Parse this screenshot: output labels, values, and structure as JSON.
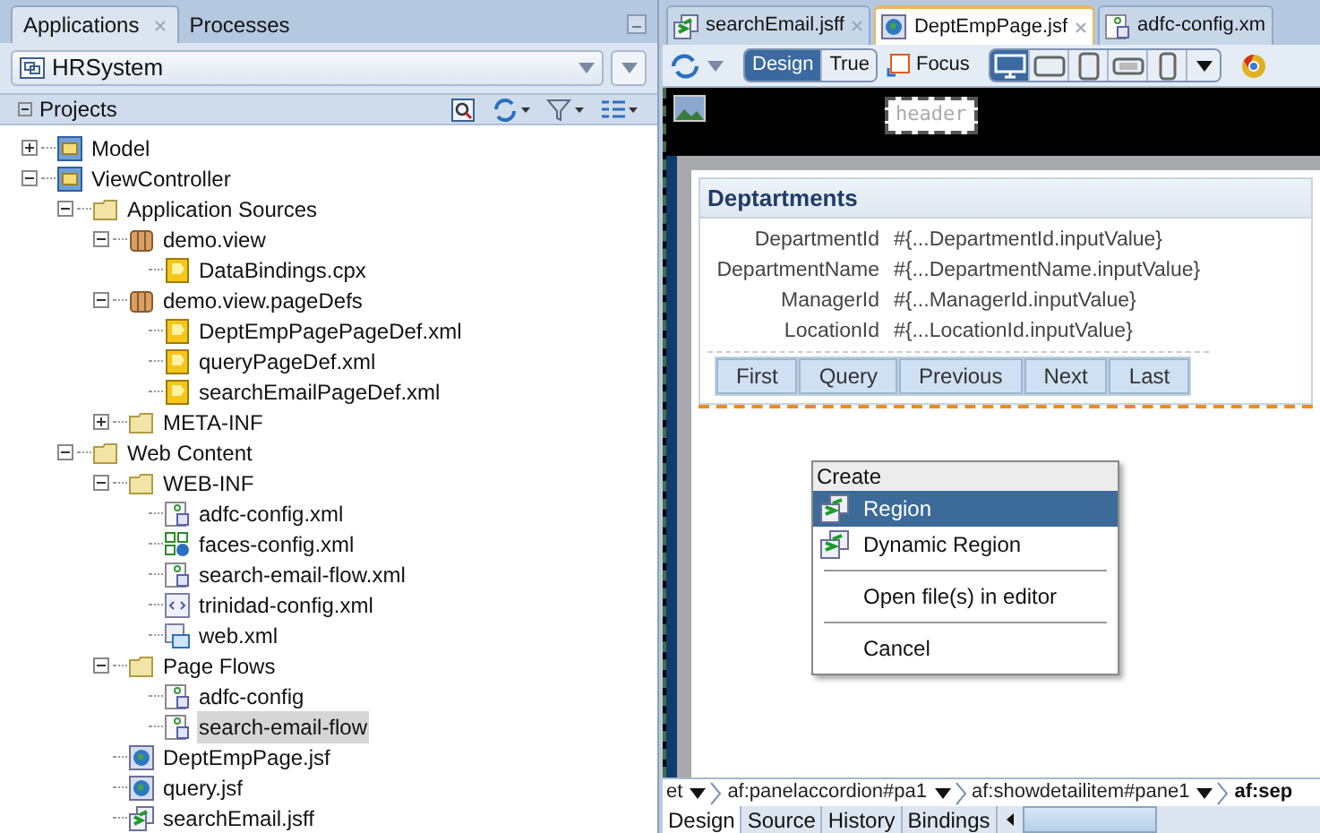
{
  "left_tabs": [
    {
      "label": "Applications",
      "selected": true,
      "closable": true
    },
    {
      "label": "Processes",
      "selected": false,
      "closable": false
    }
  ],
  "application": {
    "value": "HRSystem"
  },
  "projects_header": {
    "title": "Projects"
  },
  "tree": [
    {
      "label": "Model",
      "kind": "project",
      "expanded": false,
      "selected": false
    },
    {
      "label": "ViewController",
      "kind": "project",
      "expanded": true,
      "selected": false,
      "children": [
        {
          "label": "Application Sources",
          "kind": "folder",
          "expanded": true,
          "selected": false,
          "children": [
            {
              "label": "demo.view",
              "kind": "package",
              "expanded": true,
              "selected": false,
              "children": [
                {
                  "label": "DataBindings.cpx",
                  "kind": "binding",
                  "selected": false
                }
              ]
            },
            {
              "label": "demo.view.pageDefs",
              "kind": "package",
              "expanded": true,
              "selected": false,
              "children": [
                {
                  "label": "DeptEmpPagePageDef.xml",
                  "kind": "binding",
                  "selected": false
                },
                {
                  "label": "queryPageDef.xml",
                  "kind": "binding",
                  "selected": false
                },
                {
                  "label": "searchEmailPageDef.xml",
                  "kind": "binding",
                  "selected": false
                }
              ]
            },
            {
              "label": "META-INF",
              "kind": "folder",
              "expanded": false,
              "selected": false
            }
          ]
        },
        {
          "label": "Web Content",
          "kind": "folder",
          "expanded": true,
          "selected": false,
          "children": [
            {
              "label": "WEB-INF",
              "kind": "folder",
              "expanded": true,
              "selected": false,
              "children": [
                {
                  "label": "adfc-config.xml",
                  "kind": "flow",
                  "selected": false
                },
                {
                  "label": "faces-config.xml",
                  "kind": "faces",
                  "selected": false
                },
                {
                  "label": "search-email-flow.xml",
                  "kind": "flow",
                  "selected": false
                },
                {
                  "label": "trinidad-config.xml",
                  "kind": "xml",
                  "selected": false
                },
                {
                  "label": "web.xml",
                  "kind": "web",
                  "selected": false
                }
              ]
            },
            {
              "label": "Page Flows",
              "kind": "folder",
              "expanded": true,
              "selected": false,
              "children": [
                {
                  "label": "adfc-config",
                  "kind": "flow",
                  "selected": false
                },
                {
                  "label": "search-email-flow",
                  "kind": "flow",
                  "selected": true
                }
              ]
            },
            {
              "label": "DeptEmpPage.jsf",
              "kind": "jsf",
              "selected": false
            },
            {
              "label": "query.jsf",
              "kind": "jsf",
              "selected": false
            },
            {
              "label": "searchEmail.jsff",
              "kind": "jsff",
              "selected": false
            }
          ]
        }
      ]
    }
  ],
  "editor_tabs": [
    {
      "label": "searchEmail.jsff",
      "kind": "jsff",
      "selected": false,
      "closable": true
    },
    {
      "label": "DeptEmpPage.jsf",
      "kind": "jsf",
      "selected": true,
      "closable": true
    },
    {
      "label": "adfc-config.xm",
      "kind": "flow",
      "selected": false,
      "closable": false
    }
  ],
  "mode_toggle": [
    {
      "label": "Design",
      "selected": true
    },
    {
      "label": "True",
      "selected": false
    }
  ],
  "focus_button": {
    "label": "Focus"
  },
  "devices": [
    {
      "kind": "desktop",
      "selected": true
    },
    {
      "kind": "tablet-landscape",
      "selected": false
    },
    {
      "kind": "tablet-portrait",
      "selected": false
    },
    {
      "kind": "phone-landscape",
      "selected": false
    },
    {
      "kind": "phone-portrait",
      "selected": false
    }
  ],
  "canvas": {
    "header_facet": "header",
    "panel_title": "Deptartments",
    "fields": [
      {
        "label": "DepartmentId",
        "value": "#{...DepartmentId.inputValue}"
      },
      {
        "label": "DepartmentName",
        "value": "#{...DepartmentName.inputValue}"
      },
      {
        "label": "ManagerId",
        "value": "#{...ManagerId.inputValue}"
      },
      {
        "label": "LocationId",
        "value": "#{...LocationId.inputValue}"
      }
    ],
    "buttons": [
      "First",
      "Query",
      "Previous",
      "Next",
      "Last"
    ]
  },
  "context_menu": {
    "title": "Create",
    "items": [
      {
        "kind": "item",
        "label": "Region",
        "icon": true,
        "selected": true
      },
      {
        "kind": "item",
        "label": "Dynamic Region",
        "icon": true,
        "selected": false
      },
      {
        "kind": "separator"
      },
      {
        "kind": "item",
        "label": "Open file(s) in editor",
        "icon": false,
        "selected": false
      },
      {
        "kind": "separator"
      },
      {
        "kind": "item",
        "label": "Cancel",
        "icon": false,
        "selected": false
      }
    ]
  },
  "breadcrumb": [
    {
      "label": "et",
      "current": false
    },
    {
      "label": "af:panelaccordion#pa1",
      "current": false
    },
    {
      "label": "af:showdetailitem#pane1",
      "current": false
    },
    {
      "label": "af:sep",
      "current": true
    }
  ],
  "bottom_tabs": [
    {
      "label": "Design",
      "selected": true
    },
    {
      "label": "Source",
      "selected": false
    },
    {
      "label": "History",
      "selected": false
    },
    {
      "label": "Bindings",
      "selected": false
    }
  ]
}
